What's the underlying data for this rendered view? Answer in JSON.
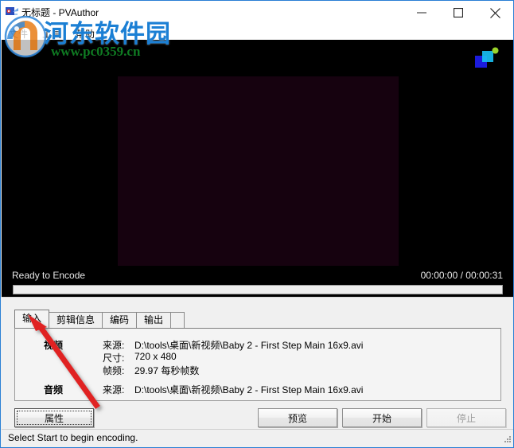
{
  "window": {
    "title": "无标题 - PVAuthor",
    "app_icon": "pvauthor-app-icon",
    "controls": {
      "minimize": "minimize-icon",
      "maximize": "maximize-icon",
      "close": "close-icon"
    }
  },
  "menu": {
    "items": [
      {
        "label": "文件"
      },
      {
        "label": "工具"
      },
      {
        "label": "帮助"
      }
    ]
  },
  "preview": {
    "brand_icon": "pvauthor-brand-icon",
    "encode_status": "Ready to Encode",
    "time_display": "00:00:00 / 00:00:31",
    "elapsed": "00:00:00",
    "total": "00:00:31",
    "progress_percent": 0,
    "frame_color": "#16020f",
    "background_color": "#000000"
  },
  "tabs": [
    {
      "label": "输入",
      "active": true
    },
    {
      "label": "剪辑信息",
      "active": false
    },
    {
      "label": "编码",
      "active": false
    },
    {
      "label": "输出",
      "active": false
    }
  ],
  "input_panel": {
    "video": {
      "section_label": "视频",
      "fields": [
        {
          "key": "来源:",
          "value": "D:\\tools\\桌面\\新视频\\Baby 2 - First Step Main 16x9.avi"
        },
        {
          "key": "尺寸:",
          "value": "720 x 480"
        },
        {
          "key": "帧频:",
          "value": "29.97 每秒帧数"
        }
      ]
    },
    "audio": {
      "section_label": "音频",
      "fields": [
        {
          "key": "来源:",
          "value": "D:\\tools\\桌面\\新视频\\Baby 2 - First Step Main 16x9.avi"
        }
      ]
    }
  },
  "buttons": {
    "properties": {
      "label": "属性",
      "enabled": true,
      "focused": true
    },
    "preview": {
      "label": "预览",
      "enabled": true,
      "focused": false
    },
    "start": {
      "label": "开始",
      "enabled": true,
      "focused": false
    },
    "stop": {
      "label": "停止",
      "enabled": false,
      "focused": false
    }
  },
  "statusbar": {
    "message": "Select Start to begin encoding.",
    "resize_grip": "resize-grip-icon"
  },
  "watermark": {
    "site_name": "河东软件园",
    "url": "www.pc0359.cn",
    "logo": "hedong-logo-icon",
    "text_color": "#1b7fd4",
    "url_color": "#0f7a22"
  },
  "annotation": {
    "arrow": "red-arrow-annotation",
    "color": "#e02020"
  }
}
